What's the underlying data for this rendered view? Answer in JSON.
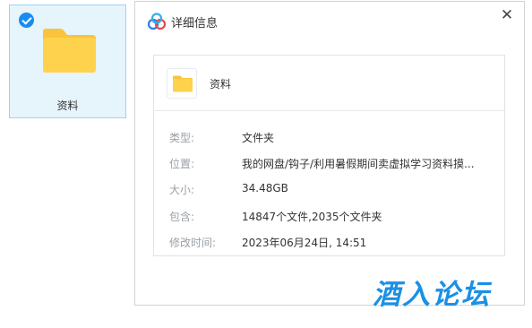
{
  "tile": {
    "label": "资料"
  },
  "dialog": {
    "title": "详细信息",
    "close": "✕",
    "name": "资料",
    "rows": [
      {
        "key": "类型:",
        "value": "文件夹"
      },
      {
        "key": "位置:",
        "value": "我的网盘/钩子/利用暑假期间卖虚拟学习资料摸..."
      },
      {
        "key": "大小:",
        "value": "34.48GB"
      },
      {
        "key": "包含:",
        "value": "14847个文件,2035个文件夹"
      },
      {
        "key": "修改时间:",
        "value": "2023年06月24日, 14:51"
      }
    ]
  },
  "watermark": {
    "text": "酒入论坛"
  },
  "colors": {
    "accent": "#1a8cf0",
    "folder": "#ffd24d",
    "watermark": "#1a90e6"
  }
}
